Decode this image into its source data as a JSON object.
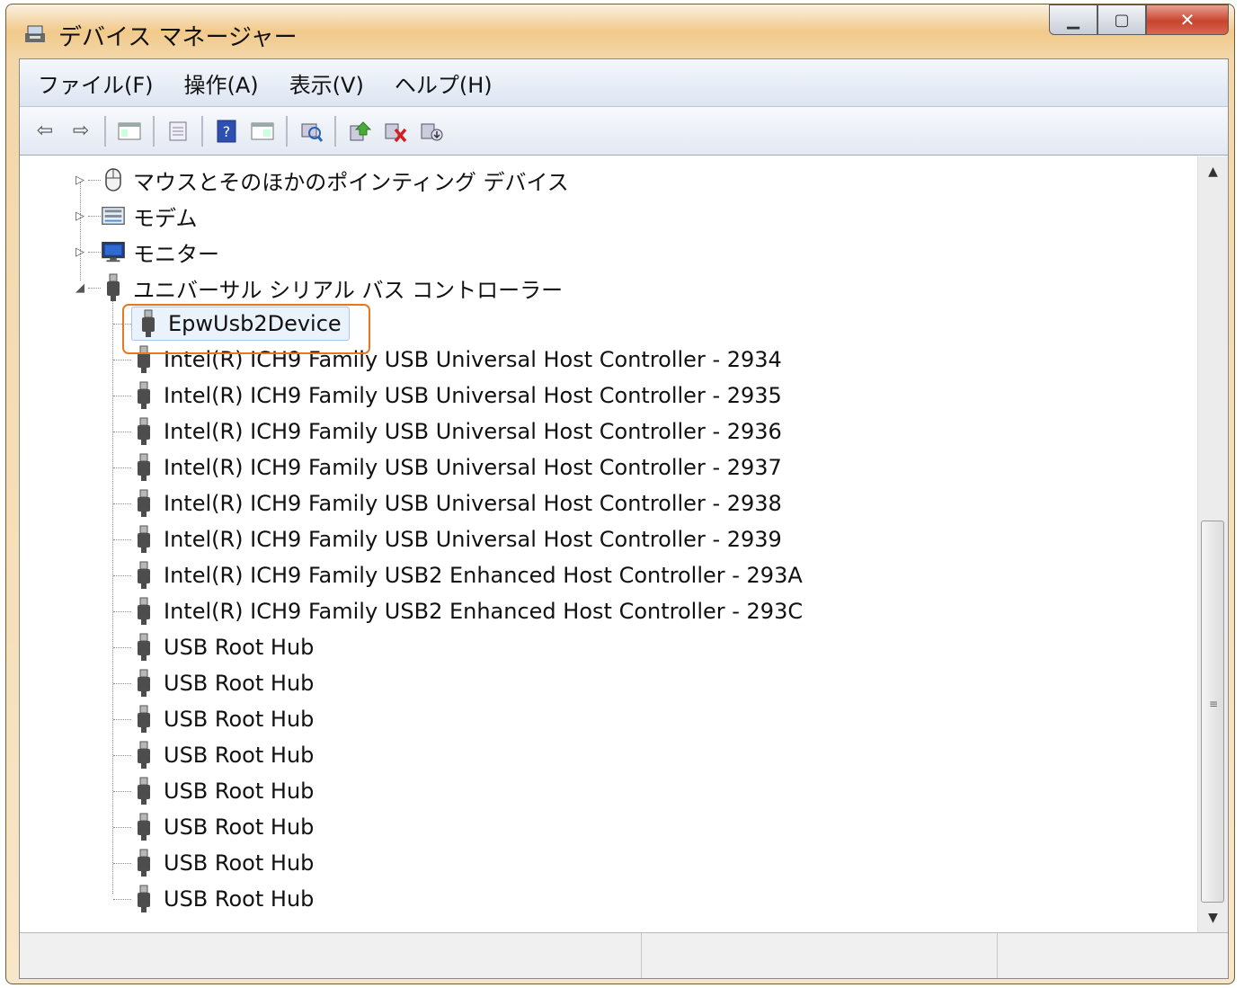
{
  "window": {
    "title": "デバイス マネージャー"
  },
  "menu": [
    "ファイル(F)",
    "操作(A)",
    "表示(V)",
    "ヘルプ(H)"
  ],
  "toolbar_icons": [
    "back-icon",
    "forward-icon",
    "show-hide-console-tree-icon",
    "properties-icon",
    "help-icon",
    "view-icon",
    "scan-hardware-icon",
    "update-driver-icon",
    "uninstall-icon",
    "disable-icon"
  ],
  "tree": {
    "categories": [
      {
        "label": "マウスとそのほかのポインティング デバイス",
        "expanded": false,
        "icon": "mouse-icon"
      },
      {
        "label": "モデム",
        "expanded": false,
        "icon": "modem-icon"
      },
      {
        "label": "モニター",
        "expanded": false,
        "icon": "monitor-icon"
      },
      {
        "label": "ユニバーサル シリアル バス コントローラー",
        "expanded": true,
        "icon": "usb-icon"
      }
    ],
    "usb_children": [
      "EpwUsb2Device",
      "Intel(R) ICH9 Family USB Universal Host Controller - 2934",
      "Intel(R) ICH9 Family USB Universal Host Controller - 2935",
      "Intel(R) ICH9 Family USB Universal Host Controller - 2936",
      "Intel(R) ICH9 Family USB Universal Host Controller - 2937",
      "Intel(R) ICH9 Family USB Universal Host Controller - 2938",
      "Intel(R) ICH9 Family USB Universal Host Controller - 2939",
      "Intel(R) ICH9 Family USB2 Enhanced Host Controller - 293A",
      "Intel(R) ICH9 Family USB2 Enhanced Host Controller - 293C",
      "USB Root Hub",
      "USB Root Hub",
      "USB Root Hub",
      "USB Root Hub",
      "USB Root Hub",
      "USB Root Hub",
      "USB Root Hub",
      "USB Root Hub"
    ],
    "selected_child": "EpwUsb2Device"
  },
  "colors": {
    "highlight": "#e87722",
    "title_gradient": "#f2c98a"
  }
}
